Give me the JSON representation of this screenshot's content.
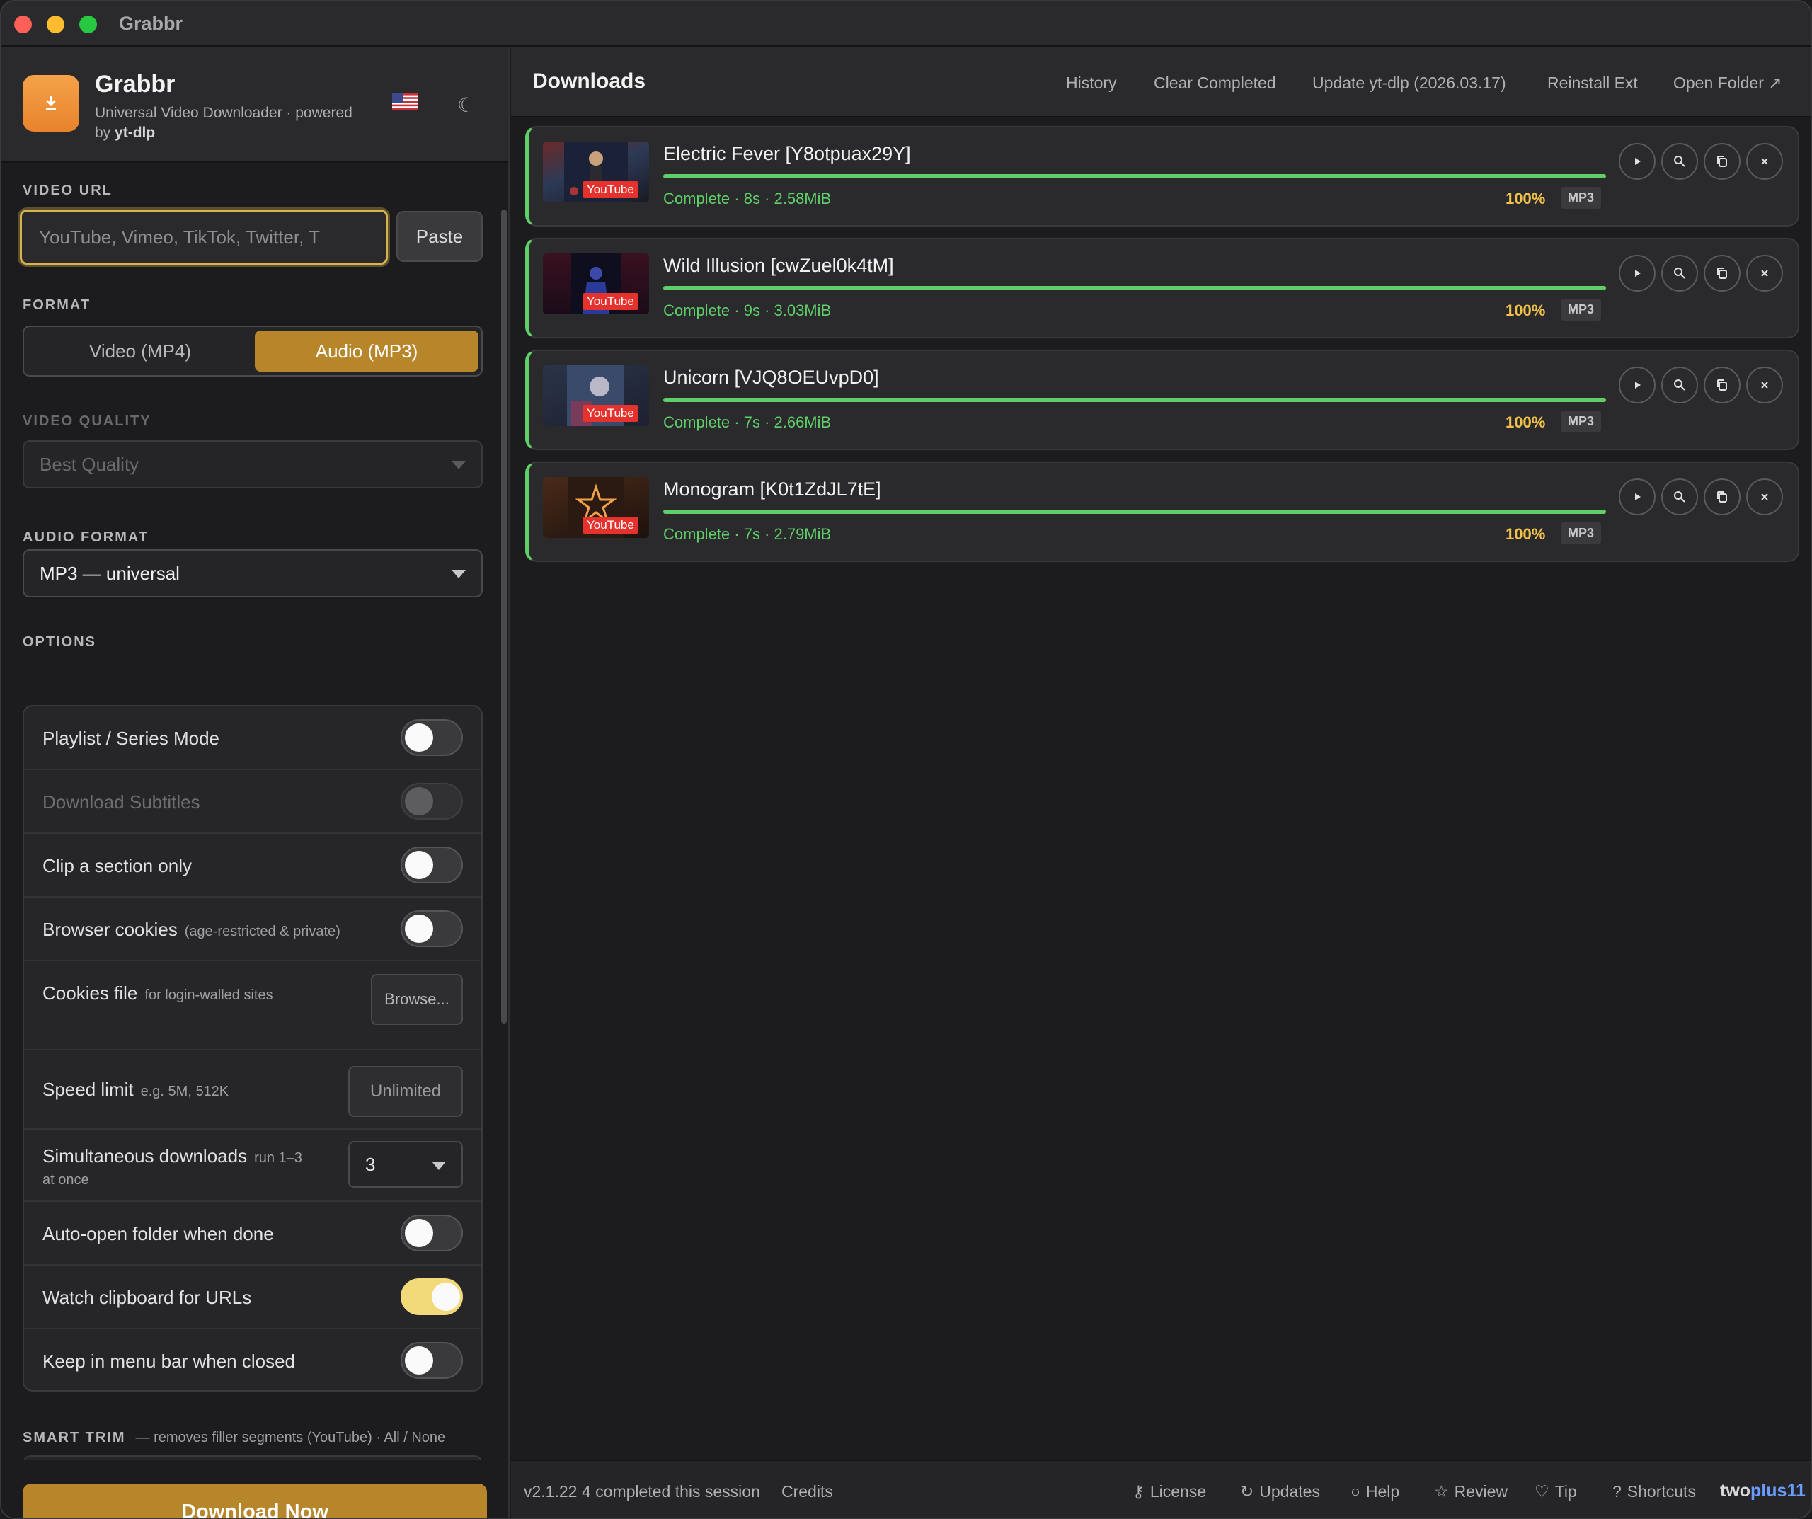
{
  "window": {
    "title": "Grabbr"
  },
  "brand": {
    "name": "Grabbr",
    "subtitle": "Universal Video Downloader · powered",
    "subtitle_by": "by",
    "subtitle_tool": "yt-dlp"
  },
  "sidebar": {
    "video_url_label": "VIDEO URL",
    "url_placeholder": "YouTube, Vimeo, TikTok, Twitter, T",
    "paste_label": "Paste",
    "format_label": "FORMAT",
    "format_options": [
      "Video (MP4)",
      "Audio (MP3)"
    ],
    "format_selected": "Audio (MP3)",
    "video_quality_label": "VIDEO QUALITY",
    "video_quality_value": "Best Quality",
    "audio_format_label": "AUDIO FORMAT",
    "audio_format_value": "MP3 — universal",
    "options_label": "OPTIONS",
    "options": {
      "playlist": {
        "label": "Playlist / Series Mode",
        "on": false
      },
      "subtitles": {
        "label": "Download Subtitles",
        "on": false,
        "disabled": true
      },
      "clip": {
        "label": "Clip a section only",
        "on": false
      },
      "cookies": {
        "label": "Browser cookies",
        "hint": "(age-restricted & private)",
        "on": false
      },
      "cookies_file": {
        "label": "Cookies file",
        "hint": "for login-walled sites",
        "button": "Browse..."
      },
      "speed_limit": {
        "label": "Speed limit",
        "hint": "e.g. 5M, 512K",
        "placeholder": "Unlimited"
      },
      "simultaneous": {
        "label": "Simultaneous downloads",
        "hint": "run 1–3",
        "hint2": "at once",
        "value": "3"
      },
      "auto_open": {
        "label": "Auto-open folder when done",
        "on": false
      },
      "watch_clipboard": {
        "label": "Watch clipboard for URLs",
        "on": true
      },
      "menu_bar": {
        "label": "Keep in menu bar when closed",
        "on": false
      }
    },
    "smart_trim_label": "SMART TRIM",
    "smart_trim_hint": "— removes filler segments (YouTube) · All / None",
    "download_button": "Download Now"
  },
  "main": {
    "title": "Downloads",
    "header_links": {
      "history": "History",
      "clear": "Clear Completed",
      "update": "Update yt-dlp (2026.03.17)",
      "reinstall": "Reinstall Ext",
      "open_folder": "Open Folder ↗"
    },
    "downloads": [
      {
        "title": "Electric Fever [Y8otpuax29Y]",
        "status": "Complete · 8s · 2.58MiB",
        "progress": 1.0,
        "percent": "100%",
        "format": "MP3",
        "source": "YouTube"
      },
      {
        "title": "Wild Illusion [cwZuel0k4tM]",
        "status": "Complete · 9s · 3.03MiB",
        "progress": 1.0,
        "percent": "100%",
        "format": "MP3",
        "source": "YouTube"
      },
      {
        "title": "Unicorn [VJQ8OEUvpD0]",
        "status": "Complete · 7s · 2.66MiB",
        "progress": 1.0,
        "percent": "100%",
        "format": "MP3",
        "source": "YouTube"
      },
      {
        "title": "Monogram [K0t1ZdJL7tE]",
        "status": "Complete · 7s · 2.79MiB",
        "progress": 1.0,
        "percent": "100%",
        "format": "MP3",
        "source": "YouTube"
      }
    ]
  },
  "footer": {
    "version": "v2.1.22",
    "session": "4 completed this session",
    "credits": "Credits",
    "license": "License",
    "updates": "Updates",
    "help": "Help",
    "review": "Review",
    "tip": "Tip",
    "shortcuts": "Shortcuts",
    "brand_a": "two",
    "brand_b": "plus11"
  },
  "colors": {
    "accent": "#b8862a",
    "success": "#5fcf6a",
    "percent": "#f2c14a",
    "focus_ring": "#d6b34c",
    "youtube_red": "#e5322d"
  }
}
